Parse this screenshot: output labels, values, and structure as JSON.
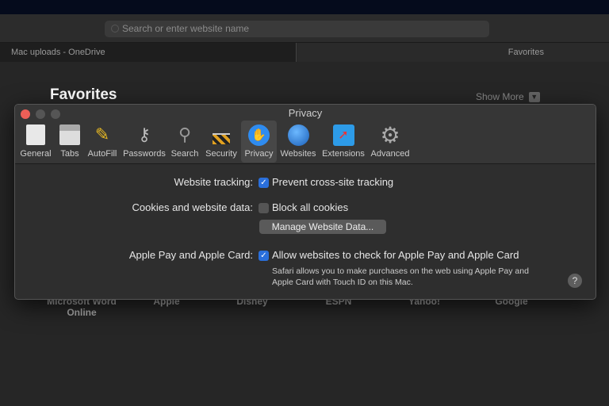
{
  "browser": {
    "search_placeholder": "Search or enter website name",
    "tabs": [
      "Mac uploads - OneDrive",
      "Favorites"
    ]
  },
  "favorites": {
    "heading": "Favorites",
    "show_more": "Show More",
    "items": [
      "Microsoft Word Online",
      "Apple",
      "Disney",
      "ESPN",
      "Yahoo!",
      "Google"
    ]
  },
  "prefs": {
    "title": "Privacy",
    "panes": [
      "General",
      "Tabs",
      "AutoFill",
      "Passwords",
      "Search",
      "Security",
      "Privacy",
      "Websites",
      "Extensions",
      "Advanced"
    ],
    "tracking_label": "Website tracking:",
    "tracking_option": "Prevent cross-site tracking",
    "tracking_checked": true,
    "cookies_label": "Cookies and website data:",
    "cookies_option": "Block all cookies",
    "cookies_checked": false,
    "manage_button": "Manage Website Data...",
    "applepay_label": "Apple Pay and Apple Card:",
    "applepay_option": "Allow websites to check for Apple Pay and Apple Card",
    "applepay_checked": true,
    "applepay_note": "Safari allows you to make purchases on the web using Apple Pay and Apple Card with Touch ID on this Mac.",
    "help": "?"
  }
}
